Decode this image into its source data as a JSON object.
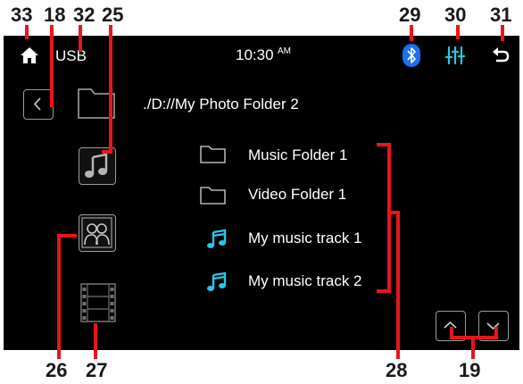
{
  "callouts": {
    "home": "33",
    "back": "18",
    "source": "32",
    "music_mode": "25",
    "bluetooth": "29",
    "eq": "30",
    "return": "31",
    "photo_mode": "26",
    "video_mode": "27",
    "file_list": "28",
    "page_scroll": "19"
  },
  "status_bar": {
    "source_label": "USB",
    "time": "10:30",
    "ampm": "AM"
  },
  "browser": {
    "path": "./D://My Photo Folder 2",
    "items": [
      {
        "label": "Music Folder 1",
        "icon": "folder-icon"
      },
      {
        "label": "Video Folder 1",
        "icon": "folder-icon"
      },
      {
        "label": "My music track 1",
        "icon": "music-note-icon"
      },
      {
        "label": "My music track 2",
        "icon": "music-note-icon"
      }
    ]
  },
  "colors": {
    "accent_cyan": "#29c5e6",
    "bluetooth_blue": "#1e6ff0",
    "callout_red": "#e8141e",
    "button_border": "#9a9a9a"
  }
}
